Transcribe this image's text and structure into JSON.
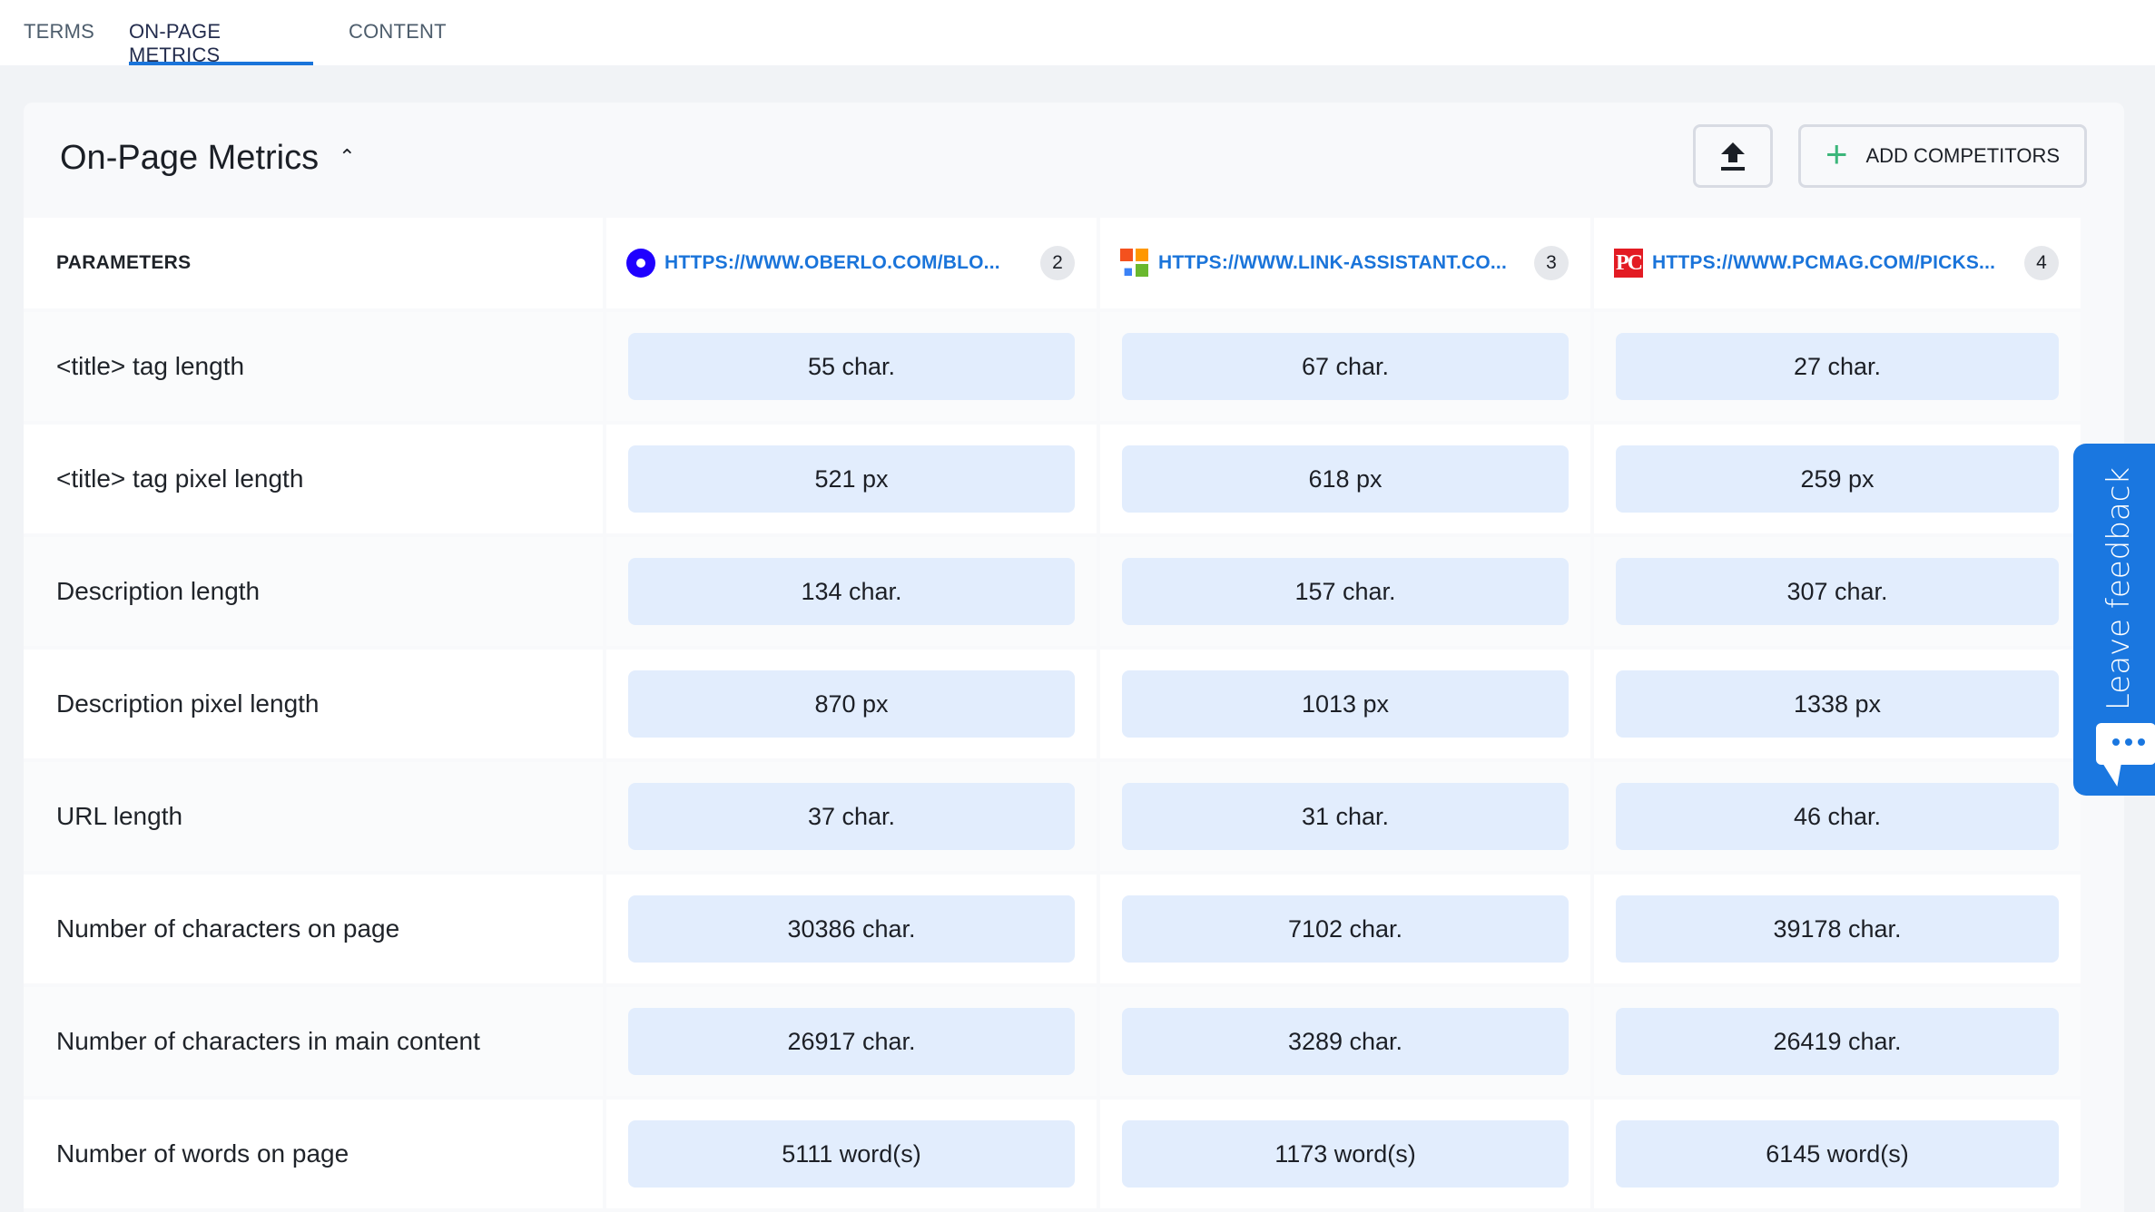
{
  "tabs": [
    {
      "label": "TERMS",
      "active": false
    },
    {
      "label": "ON-PAGE METRICS",
      "active": true
    },
    {
      "label": "CONTENT",
      "active": false
    }
  ],
  "panel": {
    "title": "On-Page Metrics",
    "collapse_icon": "chevron-up-icon",
    "upload_icon": "upload-icon",
    "add_competitors_label": "ADD COMPETITORS"
  },
  "table": {
    "param_header": "PARAMETERS",
    "competitors": [
      {
        "url": "HTTPS://WWW.OBERLO.COM/BLO...",
        "rank": "2",
        "favicon": "oberlo-favicon"
      },
      {
        "url": "HTTPS://WWW.LINK-ASSISTANT.CO...",
        "rank": "3",
        "favicon": "link-assistant-favicon"
      },
      {
        "url": "HTTPS://WWW.PCMAG.COM/PICKS...",
        "rank": "4",
        "favicon": "pcmag-favicon"
      }
    ],
    "rows": [
      {
        "label": "<title> tag length",
        "values": [
          "55 char.",
          "67 char.",
          "27 char."
        ]
      },
      {
        "label": "<title> tag pixel length",
        "values": [
          "521 px",
          "618 px",
          "259 px"
        ]
      },
      {
        "label": "Description length",
        "values": [
          "134 char.",
          "157 char.",
          "307 char."
        ]
      },
      {
        "label": "Description pixel length",
        "values": [
          "870 px",
          "1013 px",
          "1338 px"
        ]
      },
      {
        "label": "URL length",
        "values": [
          "37 char.",
          "31 char.",
          "46 char."
        ]
      },
      {
        "label": "Number of characters on page",
        "values": [
          "30386 char.",
          "7102 char.",
          "39178 char."
        ]
      },
      {
        "label": "Number of characters in main content",
        "values": [
          "26917 char.",
          "3289 char.",
          "26419 char."
        ]
      },
      {
        "label": "Number of words on page",
        "values": [
          "5111 word(s)",
          "1173 word(s)",
          "6145 word(s)"
        ]
      }
    ]
  },
  "feedback": {
    "label": "Leave feedback",
    "icon": "chat-bubble-icon"
  },
  "colors": {
    "accent": "#1a74da",
    "value_bg": "#e2edfd",
    "plus": "#3cb67a",
    "feedback_bg": "#1a77e0"
  }
}
